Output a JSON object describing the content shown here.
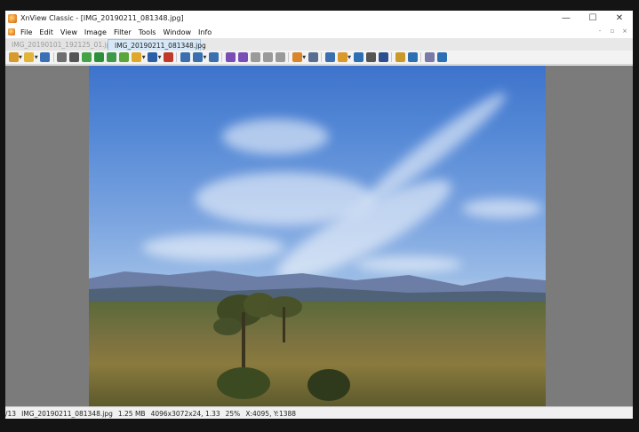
{
  "window": {
    "title": "XnView Classic - [IMG_20190211_081348.jpg]",
    "controls": {
      "minimize": "—",
      "maximize": "☐",
      "close": "✕"
    }
  },
  "menu": {
    "items": [
      "File",
      "Edit",
      "View",
      "Image",
      "Filter",
      "Tools",
      "Window",
      "Info"
    ],
    "mdi_controls": [
      "-",
      "▫",
      "×"
    ]
  },
  "tabs": [
    {
      "label": "IMG_20190101_192125_01.jpg",
      "active": false
    },
    {
      "label": "IMG_20190211_081348.jpg",
      "active": true
    }
  ],
  "toolbar": {
    "icons": [
      {
        "name": "browser-icon",
        "color": "#d89a2a",
        "dropdown": true
      },
      {
        "name": "open-folder-icon",
        "color": "#e3b43a",
        "dropdown": true
      },
      {
        "name": "save-icon",
        "color": "#3b6fb6"
      },
      {
        "name": "undo-icon",
        "color": "#6f6f6f"
      },
      {
        "name": "crop-icon",
        "color": "#555555"
      },
      {
        "name": "palette-icon",
        "color": "#46a246"
      },
      {
        "name": "adjust-icon",
        "color": "#2d8f3b"
      },
      {
        "name": "filter-icon",
        "color": "#3e9a4a"
      },
      {
        "name": "effects-icon",
        "color": "#5aa63a"
      },
      {
        "name": "rotate-icon",
        "color": "#e0a82a",
        "dropdown": true
      },
      {
        "name": "resize-icon",
        "color": "#2a5ea8",
        "dropdown": true
      },
      {
        "name": "red-eye-icon",
        "color": "#c0392b"
      },
      {
        "name": "zoom-in-icon",
        "color": "#3a6fb0"
      },
      {
        "name": "zoom-icon",
        "color": "#3a6fb0",
        "dropdown": true
      },
      {
        "name": "zoom-out-icon",
        "color": "#3a6fb0"
      },
      {
        "name": "previous-icon",
        "color": "#7a4fb5"
      },
      {
        "name": "next-icon",
        "color": "#7a4fb5"
      },
      {
        "name": "page-first-icon",
        "color": "#9a9a9a"
      },
      {
        "name": "page-icon",
        "color": "#9a9a9a"
      },
      {
        "name": "page-last-icon",
        "color": "#9a9a9a"
      },
      {
        "name": "slideshow-icon",
        "color": "#d9862a",
        "dropdown": true
      },
      {
        "name": "fullscreen-icon",
        "color": "#5a6f8f"
      },
      {
        "name": "fit-icon",
        "color": "#3a6fb0"
      },
      {
        "name": "capture-icon",
        "color": "#d99a2a",
        "dropdown": true
      },
      {
        "name": "scan-icon",
        "color": "#2d6fb3"
      },
      {
        "name": "print-icon",
        "color": "#555555"
      },
      {
        "name": "monitor-icon",
        "color": "#2c4f8f"
      },
      {
        "name": "gallery-icon",
        "color": "#c99a2a"
      },
      {
        "name": "wallpaper-icon",
        "color": "#2d6fb3"
      },
      {
        "name": "options-icon",
        "color": "#7a7aa8"
      },
      {
        "name": "about-icon",
        "color": "#2d6fb3"
      }
    ]
  },
  "status": {
    "index": "/13",
    "filename": "IMG_20190211_081348.jpg",
    "filesize": "1.25 MB",
    "dimensions": "4096x3072x24, 1.33",
    "zoom": "25%",
    "coordinates": "X:4095, Y:1388"
  }
}
